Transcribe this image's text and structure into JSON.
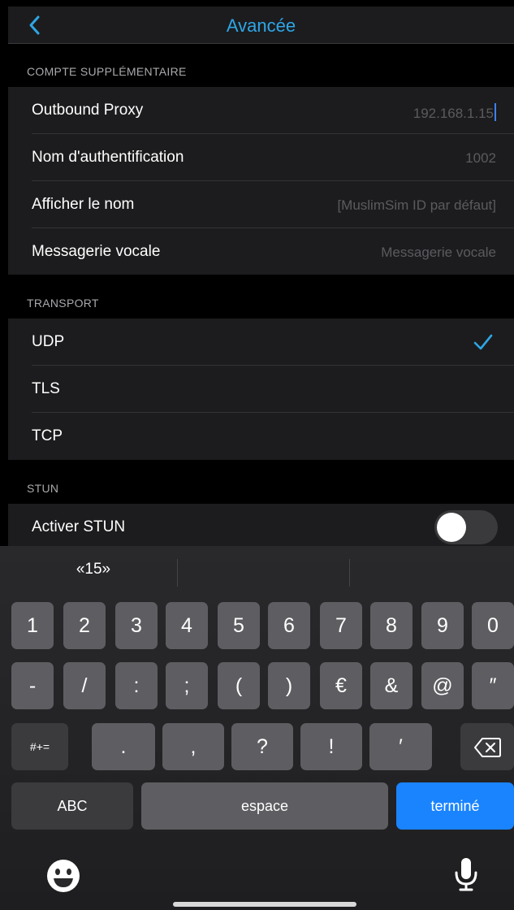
{
  "nav": {
    "title": "Avancée",
    "back_icon": "chevron-left-icon",
    "accent": "#2ea6e6"
  },
  "sections": {
    "account": {
      "header": "COMPTE SUPPLÉMENTAIRE",
      "rows": [
        {
          "label": "Outbound Proxy",
          "value": "192.168.1.15"
        },
        {
          "label": "Nom d'authentification",
          "value": "1002"
        },
        {
          "label": "Afficher le nom",
          "placeholder": "[MuslimSim ID par défaut]"
        },
        {
          "label": "Messagerie vocale",
          "placeholder": "Messagerie vocale"
        }
      ]
    },
    "transport": {
      "header": "TRANSPORT",
      "options": [
        "UDP",
        "TLS",
        "TCP"
      ],
      "selected": "UDP"
    },
    "stun": {
      "header": "STUN",
      "toggle_label": "Activer STUN",
      "enabled": false
    }
  },
  "keyboard": {
    "suggestions": [
      "«15»",
      "",
      ""
    ],
    "row1": [
      "1",
      "2",
      "3",
      "4",
      "5",
      "6",
      "7",
      "8",
      "9",
      "0"
    ],
    "row2": [
      "-",
      "/",
      ":",
      ";",
      "(",
      ")",
      "€",
      "&",
      "@",
      "″"
    ],
    "row3": {
      "switch_label": "#+=",
      "keys": [
        ".",
        ",",
        "?",
        "!",
        "′"
      ],
      "delete_icon": "backspace-icon"
    },
    "row4": {
      "abc_label": "ABC",
      "space_label": "espace",
      "done_label": "terminé"
    },
    "emoji_icon": "emoji-icon",
    "mic_icon": "microphone-icon",
    "done_color": "#1a84ff"
  }
}
